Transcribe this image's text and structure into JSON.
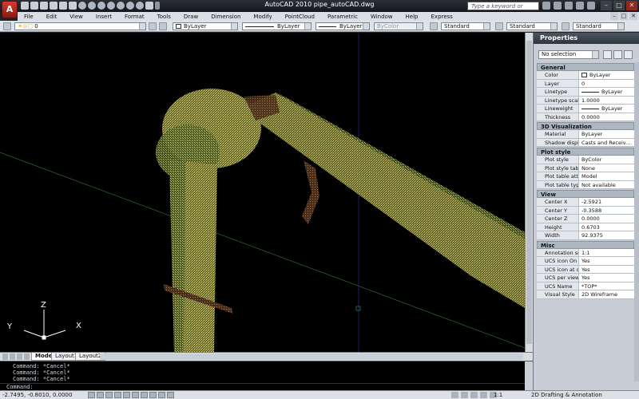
{
  "window": {
    "app_button": "A",
    "title": "AutoCAD 2010    pipe_autoCAD.dwg",
    "search_placeholder": "Type a keyword or phrase",
    "controls": [
      "–",
      "□",
      "✕"
    ]
  },
  "menu": {
    "items": [
      "File",
      "Edit",
      "View",
      "Insert",
      "Format",
      "Tools",
      "Draw",
      "Dimension",
      "Modify",
      "PointCloud",
      "Parametric",
      "Window",
      "Help",
      "Express"
    ],
    "controls": [
      "–",
      "□",
      "✕"
    ]
  },
  "toolbar": {
    "layer": "0",
    "color": "ByLayer",
    "linetype": "ByLayer",
    "lineweight": "ByLayer",
    "plotstyle": "ByColor",
    "text_style": "Standard",
    "dim_style": "Standard",
    "table_style": "Standard"
  },
  "viewport": {
    "ucs_labels": {
      "z": "Z",
      "y": "Y",
      "x": "X"
    },
    "colors": {
      "background": "#000000",
      "points_yellow": "#cfc86a",
      "points_green": "#8fb26a",
      "points_brown": "#8a5a3a",
      "axis_green": "#2e6a2e",
      "axis_blue": "#2a2a8a"
    }
  },
  "layout_tabs": [
    "Model",
    "Layout1",
    "Layout2"
  ],
  "command_line": {
    "history": [
      "Command: *Cancel*",
      "Command: *Cancel*",
      "Command: *Cancel*"
    ],
    "prompt": "Command:"
  },
  "statusbar": {
    "coordinates": "-2.7495, -0.8010, 0.0000",
    "annotation_scale": "1:1",
    "workspace": "2D Drafting & Annotation"
  },
  "properties": {
    "title": "Properties",
    "selection": "No selection",
    "sections": [
      {
        "name": "General",
        "rows": [
          {
            "k": "Color",
            "v": "ByLayer",
            "swatch": "color"
          },
          {
            "k": "Layer",
            "v": "0"
          },
          {
            "k": "Linetype",
            "v": "ByLayer",
            "swatch": "line"
          },
          {
            "k": "Linetype scale",
            "v": "1.0000"
          },
          {
            "k": "Lineweight",
            "v": "ByLayer",
            "swatch": "line"
          },
          {
            "k": "Thickness",
            "v": "0.0000"
          }
        ]
      },
      {
        "name": "3D Visualization",
        "rows": [
          {
            "k": "Material",
            "v": "ByLayer"
          },
          {
            "k": "Shadow display",
            "v": "Casts and Receiv..."
          }
        ]
      },
      {
        "name": "Plot style",
        "rows": [
          {
            "k": "Plot style",
            "v": "ByColor"
          },
          {
            "k": "Plot style table",
            "v": "None"
          },
          {
            "k": "Plot table attac...",
            "v": "Model"
          },
          {
            "k": "Plot table type",
            "v": "Not available"
          }
        ]
      },
      {
        "name": "View",
        "rows": [
          {
            "k": "Center X",
            "v": "-2.5921"
          },
          {
            "k": "Center Y",
            "v": "-0.3588"
          },
          {
            "k": "Center Z",
            "v": "0.0000"
          },
          {
            "k": "Height",
            "v": "0.6703"
          },
          {
            "k": "Width",
            "v": "92.9375"
          }
        ]
      },
      {
        "name": "Misc",
        "rows": [
          {
            "k": "Annotation scale",
            "v": "1:1"
          },
          {
            "k": "UCS icon On",
            "v": "Yes"
          },
          {
            "k": "UCS icon at origin",
            "v": "Yes"
          },
          {
            "k": "UCS per viewport",
            "v": "Yes"
          },
          {
            "k": "UCS Name",
            "v": "*TOP*"
          },
          {
            "k": "Visual Style",
            "v": "2D Wireframe"
          }
        ]
      }
    ]
  }
}
